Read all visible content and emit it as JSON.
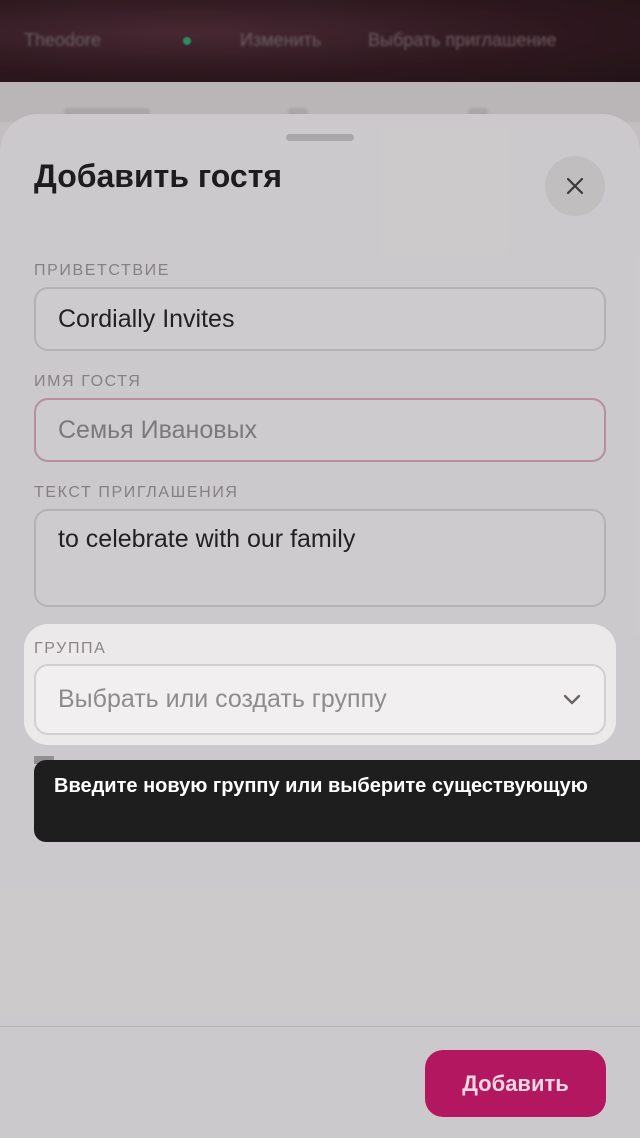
{
  "background": {
    "topbar": [
      "Theodore",
      "Изменить",
      "Выбрать приглашение"
    ]
  },
  "sheet": {
    "title": "Добавить гостя",
    "close_icon": "close-icon",
    "fields": {
      "greeting": {
        "label": "ПРИВЕТСТВИЕ",
        "value": "Cordially Invites"
      },
      "guest_name": {
        "label": "ИМЯ ГОСТЯ",
        "placeholder": "Семья Ивановых"
      },
      "invitation_text": {
        "label": "ТЕКСТ ПРИГЛАШЕНИЯ",
        "value": "to celebrate with our family"
      },
      "group": {
        "label": "ГРУППА",
        "placeholder": "Выбрать или создать группу",
        "icon": "chevron-down-icon"
      }
    },
    "tooltip": "Введите новую группу или выберите существующую",
    "add_button": "Добавить"
  },
  "colors": {
    "accent": "#b2175f",
    "error_border": "#d9a8b7",
    "tooltip_bg": "#1e1e1e"
  }
}
